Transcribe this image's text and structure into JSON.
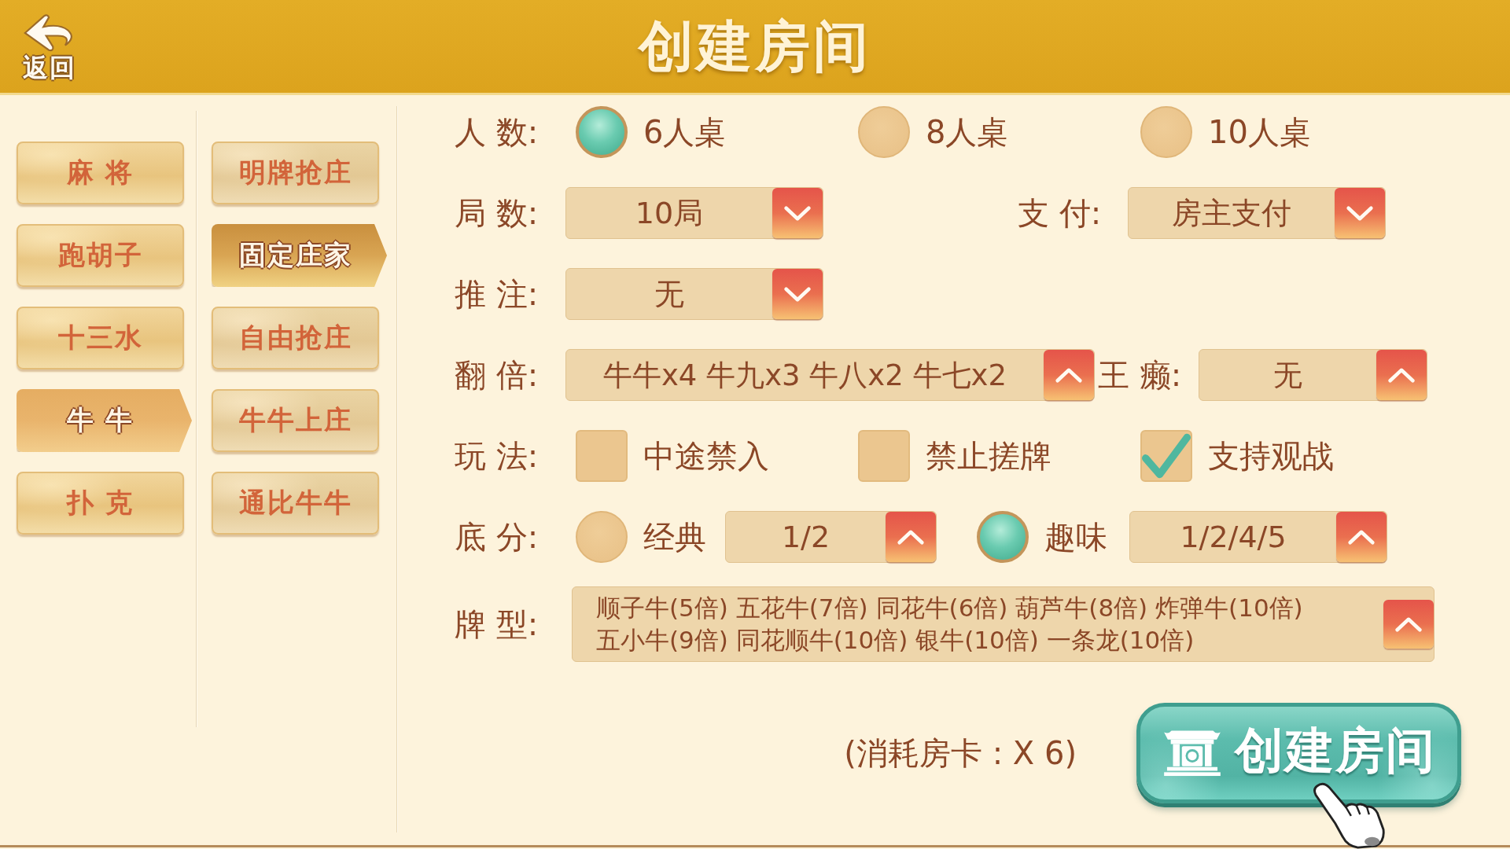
{
  "header": {
    "back_button": "返回",
    "title": "创建房间"
  },
  "game_categories": [
    {
      "label": "麻 将",
      "selected": false
    },
    {
      "label": "跑胡子",
      "selected": false
    },
    {
      "label": "十三水",
      "selected": false
    },
    {
      "label": "牛 牛",
      "selected": true
    },
    {
      "label": "扑 克",
      "selected": false
    }
  ],
  "game_modes": [
    {
      "label": "明牌抢庄",
      "selected": false
    },
    {
      "label": "固定庄家",
      "selected": true
    },
    {
      "label": "自由抢庄",
      "selected": false
    },
    {
      "label": "牛牛上庄",
      "selected": false
    },
    {
      "label": "通比牛牛",
      "selected": false
    }
  ],
  "settings": [
    {
      "label": "人 数:",
      "items": [
        {
          "kind": "radio",
          "label": "6人桌",
          "selected": true
        },
        {
          "kind": "radio",
          "label": "8人桌",
          "selected": false
        },
        {
          "kind": "radio",
          "label": "10人桌",
          "selected": false
        }
      ]
    },
    {
      "label": "局 数:",
      "items": [
        {
          "kind": "dropdown",
          "value": "10局",
          "opens_up": false
        },
        {
          "kind": "label",
          "label": "支 付:"
        },
        {
          "kind": "dropdown",
          "value": "房主支付",
          "opens_up": false
        }
      ]
    },
    {
      "label": "推 注:",
      "items": [
        {
          "kind": "dropdown",
          "value": "无",
          "opens_up": false
        }
      ]
    },
    {
      "label": "翻 倍:",
      "items": [
        {
          "kind": "dropdown",
          "value": "牛牛x4 牛九x3 牛八x2 牛七x2",
          "opens_up": true
        },
        {
          "kind": "label",
          "label": "王 癞:"
        },
        {
          "kind": "dropdown",
          "value": "无",
          "opens_up": true
        }
      ]
    },
    {
      "label": "玩 法:",
      "items": [
        {
          "kind": "checkbox",
          "label": "中途禁入",
          "checked": false
        },
        {
          "kind": "checkbox",
          "label": "禁止搓牌",
          "checked": false
        },
        {
          "kind": "checkbox",
          "label": "支持观战",
          "checked": true
        }
      ]
    },
    {
      "label": "底 分:",
      "items": [
        {
          "kind": "radio",
          "label": "经典",
          "selected": false
        },
        {
          "kind": "dropdown",
          "value": "1/2",
          "opens_up": true
        },
        {
          "kind": "radio",
          "label": "趣味",
          "selected": true
        },
        {
          "kind": "dropdown",
          "value": "1/2/4/5",
          "opens_up": true
        }
      ]
    },
    {
      "label": "牌 型:",
      "items": [
        {
          "kind": "multiline_dropdown",
          "lines": [
            "顺子牛(5倍) 五花牛(7倍) 同花牛(6倍) 葫芦牛(8倍) 炸弹牛(10倍)",
            "五小牛(9倍) 同花顺牛(10倍) 银牛(10倍) 一条龙(10倍)"
          ],
          "opens_up": true
        }
      ]
    }
  ],
  "footer": {
    "cost_note": "(消耗房卡 : X 6)",
    "create_button": "创建房间"
  }
}
